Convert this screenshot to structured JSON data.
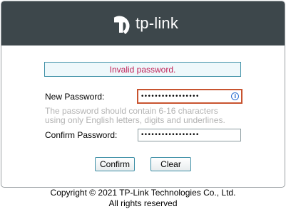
{
  "header": {
    "brand_text": "tp-link",
    "logo_icon": "tp-link-logo-icon",
    "background_color": "#3d474b"
  },
  "error": {
    "message": "Invalid password.",
    "text_color": "#c0245a"
  },
  "form": {
    "new_password_label": "New Password:",
    "new_password_value": "•••••••••••••••••",
    "info_icon_glyph": "i",
    "hint": "The password should contain 6-16 characters using only English letters, digits and underlines.",
    "confirm_password_label": "Confirm Password:",
    "confirm_password_value": "•••••••••••••••••"
  },
  "buttons": {
    "confirm_label": "Confirm",
    "clear_label": "Clear"
  },
  "footer": {
    "copyright": "Copyright © 2021  TP-Link Technologies Co., Ltd.",
    "rights": "All rights reserved"
  }
}
